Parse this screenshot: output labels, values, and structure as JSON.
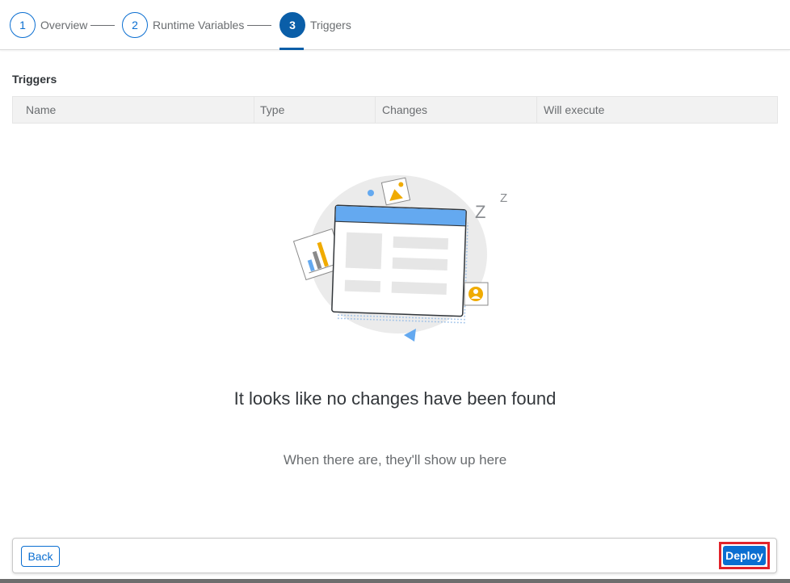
{
  "wizard": {
    "steps": [
      {
        "number": "1",
        "label": "Overview"
      },
      {
        "number": "2",
        "label": "Runtime Variables"
      },
      {
        "number": "3",
        "label": "Triggers"
      }
    ],
    "active_step": 3
  },
  "section": {
    "title": "Triggers"
  },
  "table": {
    "columns": [
      "Name",
      "Type",
      "Changes",
      "Will execute"
    ]
  },
  "empty_state": {
    "title": "It looks like no changes have been found",
    "subtitle": "When there are, they'll show up here",
    "illustration": "sleeping-document-illustration"
  },
  "footer": {
    "back_label": "Back",
    "deploy_label": "Deploy"
  },
  "colors": {
    "accent": "#0a6ed1",
    "active_step": "#0a5ea8",
    "highlight": "#e1232b"
  }
}
